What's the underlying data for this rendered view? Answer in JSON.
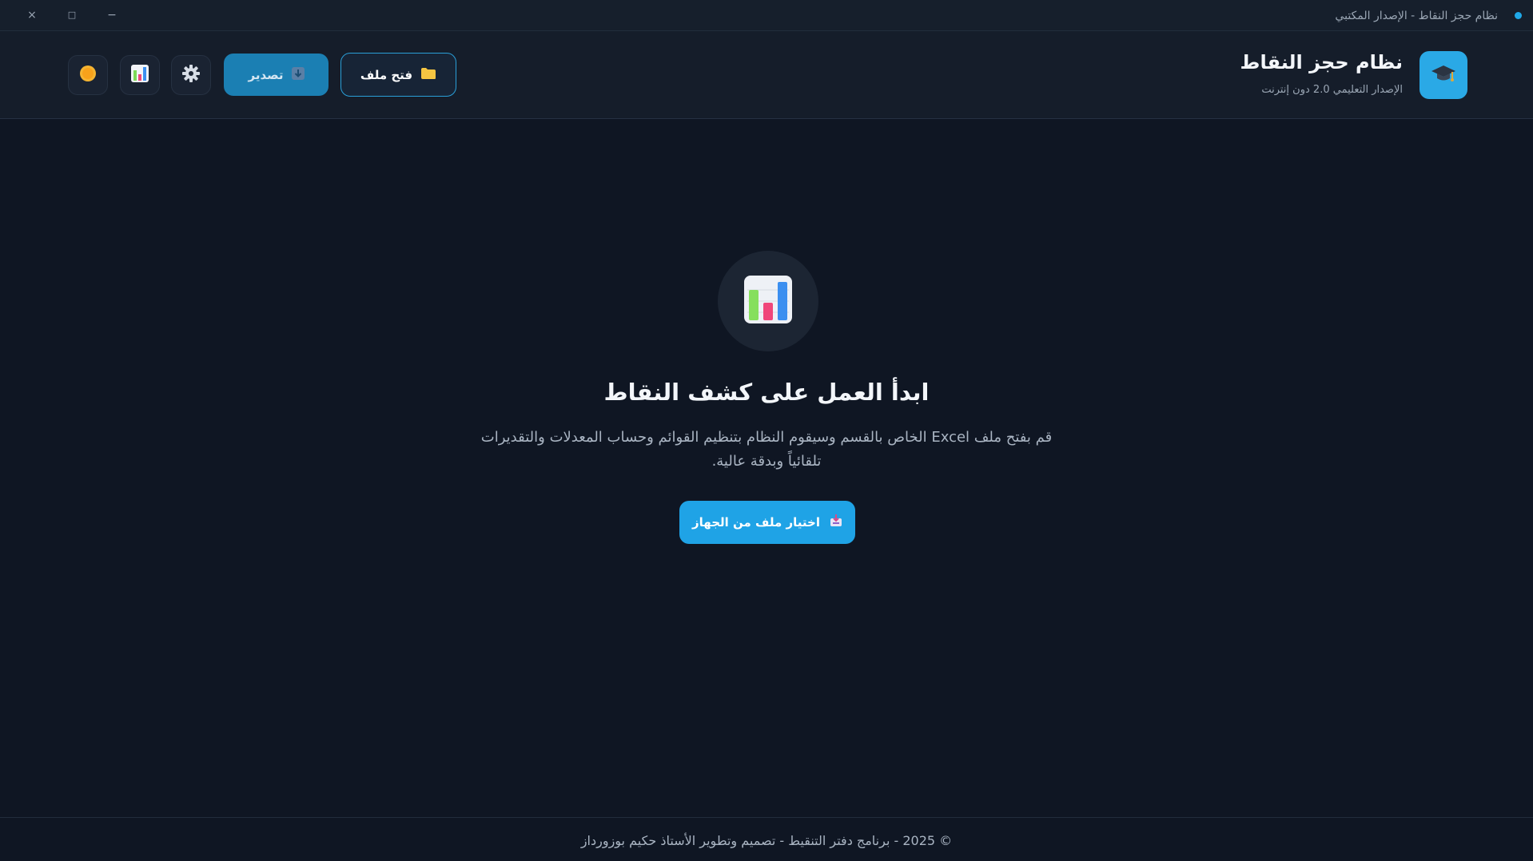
{
  "window": {
    "title": "نظام حجز النقاط - الإصدار المكتبي",
    "close_glyph": "×",
    "maximize_glyph": "□",
    "minimize_glyph": "−"
  },
  "header": {
    "app_title": "نظام حجز النقاط",
    "app_subtitle": "الإصدار التعليمي 2.0 دون إنترنت",
    "open_file_label": "فتح ملف",
    "export_label": "تصدير",
    "logo_icon": "graduation-cap-icon"
  },
  "main": {
    "title": "ابدأ العمل على كشف النقاط",
    "description": "قم بفتح ملف Excel الخاص بالقسم وسيقوم النظام بتنظيم القوائم وحساب المعدلات والتقديرات تلقائياً وبدقة عالية.",
    "choose_button_label": "اختيار ملف من الجهاز"
  },
  "footer": {
    "text": "© 2025 - برنامج دفتر التنقيط - تصميم وتطوير الأستاذ حكيم بوزورداز"
  },
  "colors": {
    "accent": "#1fa3e6",
    "background": "#0f1623",
    "header_bg": "#151d2a"
  }
}
